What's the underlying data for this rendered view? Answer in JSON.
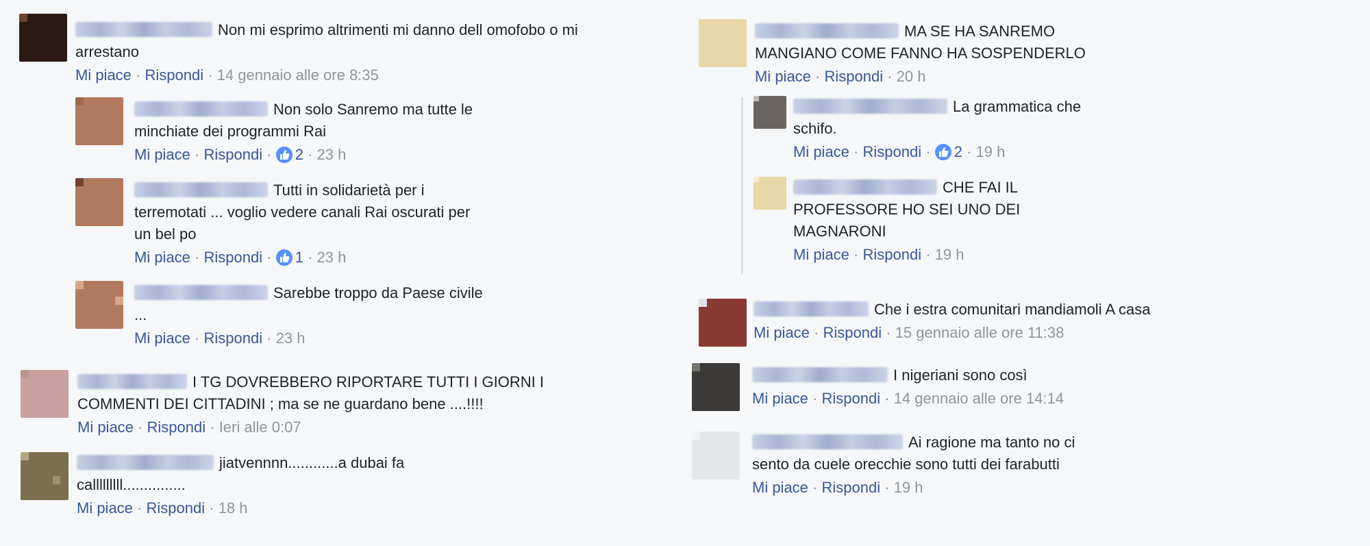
{
  "separator": "·",
  "like_label": "Mi piace",
  "reply_label": "Rispondi",
  "colors": {
    "link": "#365899",
    "meta": "#90949c",
    "like_badge": "#5890ff",
    "background": "#f6f7f9"
  },
  "left": {
    "c1": {
      "text1": "Non mi esprimo altrimenti mi danno dell omofobo o mi",
      "text2": "arrestano",
      "time": "14 gennaio alle ore 8:35"
    },
    "r1": {
      "text1": "Non solo Sanremo ma tutte le",
      "text2": "minchiate dei programmi Rai",
      "likes": "2",
      "time": "23 h"
    },
    "r2": {
      "text1": "Tutti in solidarietà per i",
      "text2": "terremotati ... voglio vedere canali Rai oscurati per",
      "text3": "un bel po",
      "likes": "1",
      "time": "23 h"
    },
    "r3": {
      "text1": "Sarebbe troppo da Paese civile",
      "text2": "...",
      "time": "23 h"
    },
    "c2": {
      "text1": "I TG DOVREBBERO RIPORTARE TUTTI I GIORNI I",
      "text2": "COMMENTI DEI CITTADINI ; ma se ne guardano bene ....!!!!",
      "time": "Ieri alle 0:07"
    },
    "c3": {
      "text1": "jiatvennnn............a dubai fa",
      "text2": "calllllllll...............",
      "time": "18 h"
    }
  },
  "right": {
    "c1": {
      "text1": "MA SE HA SANREMO",
      "text2": "MANGIANO COME FANNO HA SOSPENDERLO",
      "time": "20 h"
    },
    "r1": {
      "text1": "La grammatica che",
      "text2": "schifo.",
      "likes": "2",
      "time": "19 h"
    },
    "r2": {
      "text1": "CHE FAI IL",
      "text2": "PROFESSORE HO SEI UNO DEI",
      "text3": "MAGNARONI",
      "time": "19 h"
    },
    "c2": {
      "text1": "Che i estra comunitari mandiamoli A casa",
      "time": "15 gennaio alle ore 11:38"
    },
    "c3": {
      "text1": "I nigeriani sono così",
      "time": "14 gennaio alle ore 14:14"
    },
    "c4": {
      "text1": "Ai ragione ma tanto no ci",
      "text2": "sento da cuele orecchie sono tutti dei farabutti",
      "time": "19 h"
    }
  }
}
